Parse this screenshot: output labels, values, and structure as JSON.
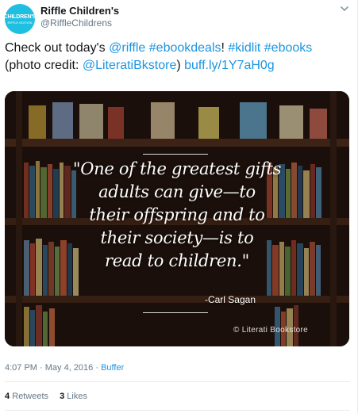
{
  "colors": {
    "accent": "#1b95e0",
    "avatar_bg": "#1ebfe0",
    "text": "#14171a",
    "muted": "#657786"
  },
  "account": {
    "avatar_line1": "CHILDREN'S",
    "avatar_line2": "RIFFLE EDITION",
    "name": "Riffle Children's",
    "handle": "@RiffleChildrens"
  },
  "tweet": {
    "text_plain_1": "Check out today's ",
    "mention_riffle": "@riffle",
    "space1": " ",
    "hashtag_ebookdeals": "#ebookdeals",
    "text_plain_2": "! ",
    "hashtag_kidlit": "#kidlit",
    "space2": " ",
    "hashtag_ebooks": "#ebooks",
    "text_plain_3": "(photo credit: ",
    "mention_literati": "@LiteratiBkstore",
    "text_plain_4": ") ",
    "link": "buff.ly/1Y7aH0g"
  },
  "media": {
    "quote_lines": [
      "\"One of the greatest gifts",
      "adults can give—to",
      "their offspring and to",
      "their society—is to",
      "read to children.\""
    ],
    "author": "-Carl Sagan",
    "credit": "© Literati Bookstore"
  },
  "meta": {
    "time": "4:07 PM",
    "sep": " · ",
    "date": "May 4, 2016",
    "sep2": " · ",
    "source": "Buffer"
  },
  "stats": {
    "retweets_count": "4",
    "retweets_label": "Retweets",
    "likes_count": "3",
    "likes_label": "Likes"
  }
}
